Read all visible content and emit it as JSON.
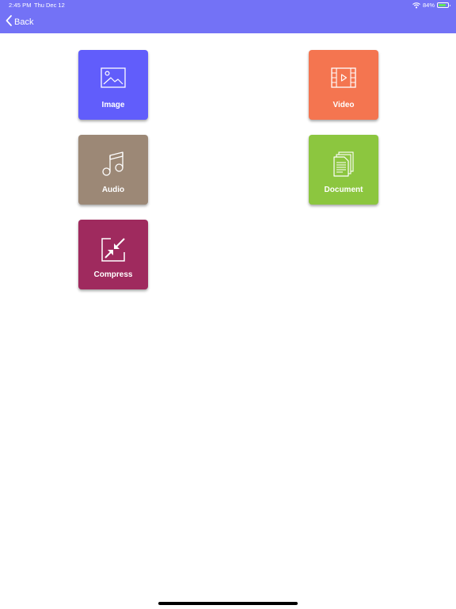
{
  "status_bar": {
    "time": "2:45 PM",
    "date": "Thu Dec 12",
    "battery_percent": "84%",
    "battery_level": 0.84,
    "battery_color": "#5ee35e",
    "icons": [
      "wifi-icon",
      "battery-icon"
    ]
  },
  "nav": {
    "back_label": "Back",
    "back_icon": "chevron-left-icon",
    "bar_color": "#7372f6"
  },
  "tiles": [
    {
      "label": "Image",
      "icon": "image-icon",
      "color": "#615dfb"
    },
    {
      "label": "Video",
      "icon": "video-film-icon",
      "color": "#f47550"
    },
    {
      "label": "Audio",
      "icon": "music-note-icon",
      "color": "#9c8876"
    },
    {
      "label": "Document",
      "icon": "document-icon",
      "color": "#8cc63f"
    },
    {
      "label": "Compress",
      "icon": "compress-icon",
      "color": "#9f2a5e"
    }
  ]
}
